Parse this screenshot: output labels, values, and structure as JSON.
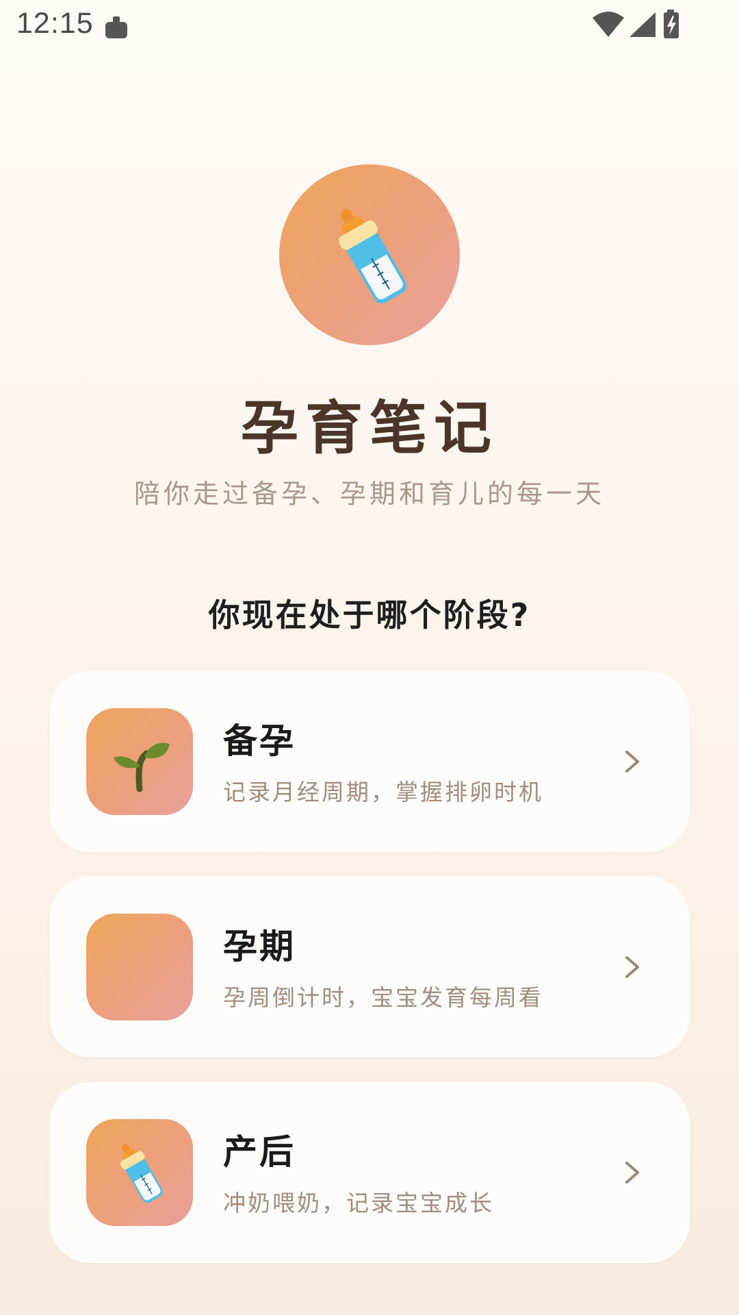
{
  "status_bar": {
    "time": "12:15",
    "icons": [
      "notification-icon",
      "wifi-icon",
      "signal-icon",
      "battery-charging-icon"
    ]
  },
  "app": {
    "logo_icon": "baby-bottle-icon",
    "title": "孕育笔记",
    "subtitle": "陪你走过备孕、孕期和育儿的每一天"
  },
  "question": "你现在处于哪个阶段?",
  "stages": [
    {
      "title": "备孕",
      "description": "记录月经周期，掌握排卵时机",
      "icon": "seedling-icon"
    },
    {
      "title": "孕期",
      "description": "孕周倒计时，宝宝发育每周看",
      "icon": ""
    },
    {
      "title": "产后",
      "description": "冲奶喂奶，记录宝宝成长",
      "icon": "baby-bottle-icon"
    }
  ],
  "colors": {
    "gradient_start": "#efa55a",
    "gradient_end": "#e99f9d",
    "title": "#4b3528",
    "subtitle": "#a8978a",
    "card_bg": "#fefcfa"
  }
}
